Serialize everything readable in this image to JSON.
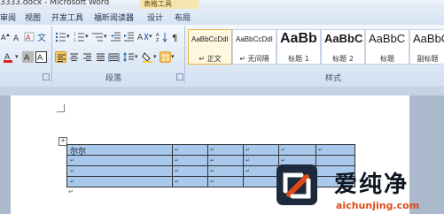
{
  "window": {
    "title": "3333.docx - Microsoft Word",
    "contextual_label": "表格工具"
  },
  "tabs": [
    "审阅",
    "视图",
    "开发工具",
    "福昕阅读器",
    "设计",
    "布局"
  ],
  "ribbon": {
    "groups": {
      "paragraph": "段落",
      "styles": "样式"
    },
    "styles": [
      {
        "sample": "AaBbCcDdI",
        "name": "↵ 正文",
        "selected": true,
        "size": "small"
      },
      {
        "sample": "AaBbCcDdI",
        "name": "↵ 无间隔",
        "selected": false,
        "size": "small"
      },
      {
        "sample": "AaBb",
        "name": "标题 1",
        "selected": false,
        "size": "h1"
      },
      {
        "sample": "AaBbC",
        "name": "标题 2",
        "selected": false,
        "size": "h2"
      },
      {
        "sample": "AaBbC",
        "name": "标题",
        "selected": false,
        "size": "h2"
      },
      {
        "sample": "AaBbC",
        "name": "副标题",
        "selected": false,
        "size": "h2"
      }
    ],
    "colors": {
      "font_color_bar": "#e02020",
      "highlight_bar": "#f3d23a",
      "border_icon": "#e89a1a"
    }
  },
  "document": {
    "table": {
      "first_cell_text": "尔尔",
      "rows": 4,
      "fill_color": "#a8c8ec"
    },
    "cell_mark": "↵"
  },
  "watermark": {
    "chinese": "爱纯净",
    "url": "aichunjing.com"
  }
}
